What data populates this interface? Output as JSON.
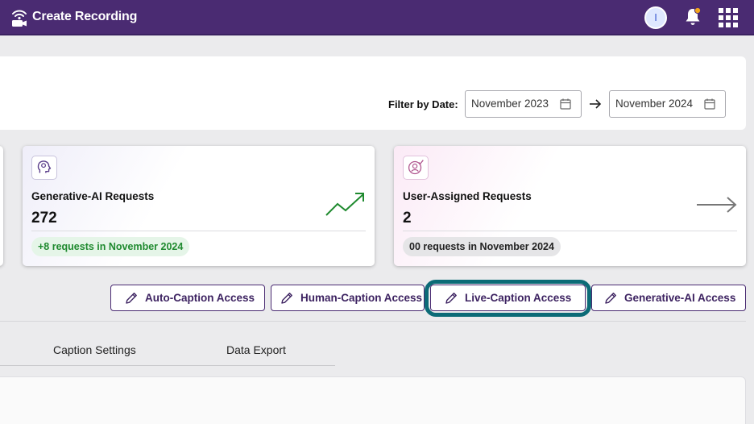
{
  "header": {
    "brand_label": "Create Recording",
    "avatar_initial": "I"
  },
  "filter": {
    "label": "Filter by Date:",
    "from_value": "November 2023",
    "to_value": "November 2024"
  },
  "cards": {
    "genai": {
      "title": "Generative-AI Requests",
      "value": "272",
      "pill": "+8 requests in November 2024",
      "trend": "up-trend-icon"
    },
    "user": {
      "title": "User-Assigned Requests",
      "value": "2",
      "pill": "00 requests in November 2024",
      "trend": "arrow-right-icon"
    }
  },
  "access_buttons": {
    "auto": "Auto-Caption Access",
    "human": "Human-Caption Access",
    "live": "Live-Caption Access",
    "genai": "Generative-AI Access"
  },
  "tabs": {
    "caption_settings": "Caption Settings",
    "data_export": "Data Export"
  },
  "colors": {
    "header_bg": "#4a2b72",
    "accent_purple": "#4a2b72",
    "focus_ring": "#0c6b77",
    "positive_green": "#1f8a2f"
  }
}
